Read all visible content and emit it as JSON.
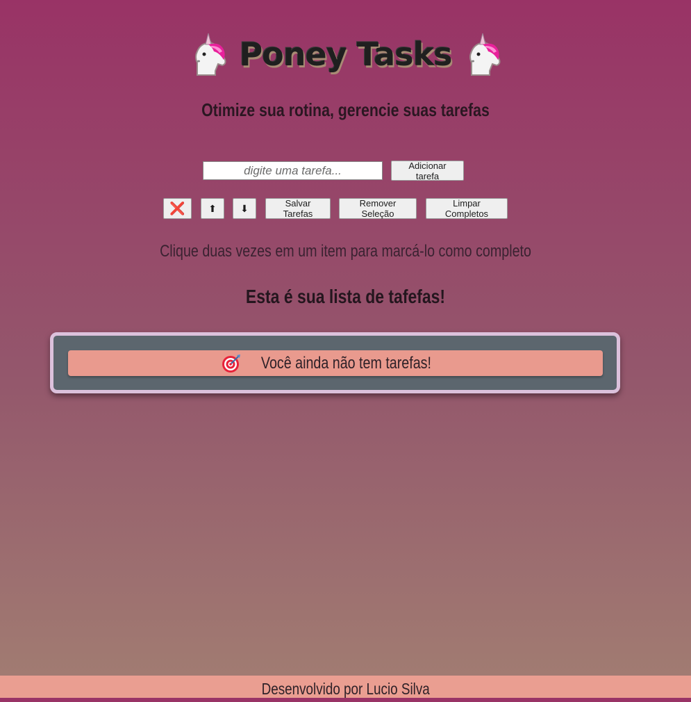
{
  "header": {
    "title": "Poney Tasks",
    "subtitle": "Otimize sua rotina, gerencie suas tarefas",
    "left_icon": "unicorn-icon",
    "right_icon": "unicorn-icon"
  },
  "add_task": {
    "placeholder": "digite uma tarefa...",
    "value": "",
    "button_label": "Adicionar tarefa"
  },
  "toolbar": {
    "delete_icon": "❌",
    "move_up_icon": "⬆",
    "move_down_icon": "⬇",
    "save_label": "Salvar Tarefas",
    "remove_selection_label": "Remover Seleção",
    "clear_completed_label": "Limpar Completos"
  },
  "hint": "Clique duas vezes em um item para marcá-lo como completo",
  "list": {
    "heading": "Esta é sua lista de tafefas!",
    "empty_message": "Você ainda não tem tarefas!",
    "empty_icon": "direct-hit-target-icon"
  },
  "footer": {
    "credit": "Desenvolvido por Lucio Silva"
  },
  "colors": {
    "background_top": "#993366",
    "background_bottom": "#a27e72",
    "list_frame_border": "#dcc1dc",
    "list_frame_bg": "#5c666e",
    "item_bg": "#e99a8e",
    "footer_bg": "#ea9e91"
  }
}
